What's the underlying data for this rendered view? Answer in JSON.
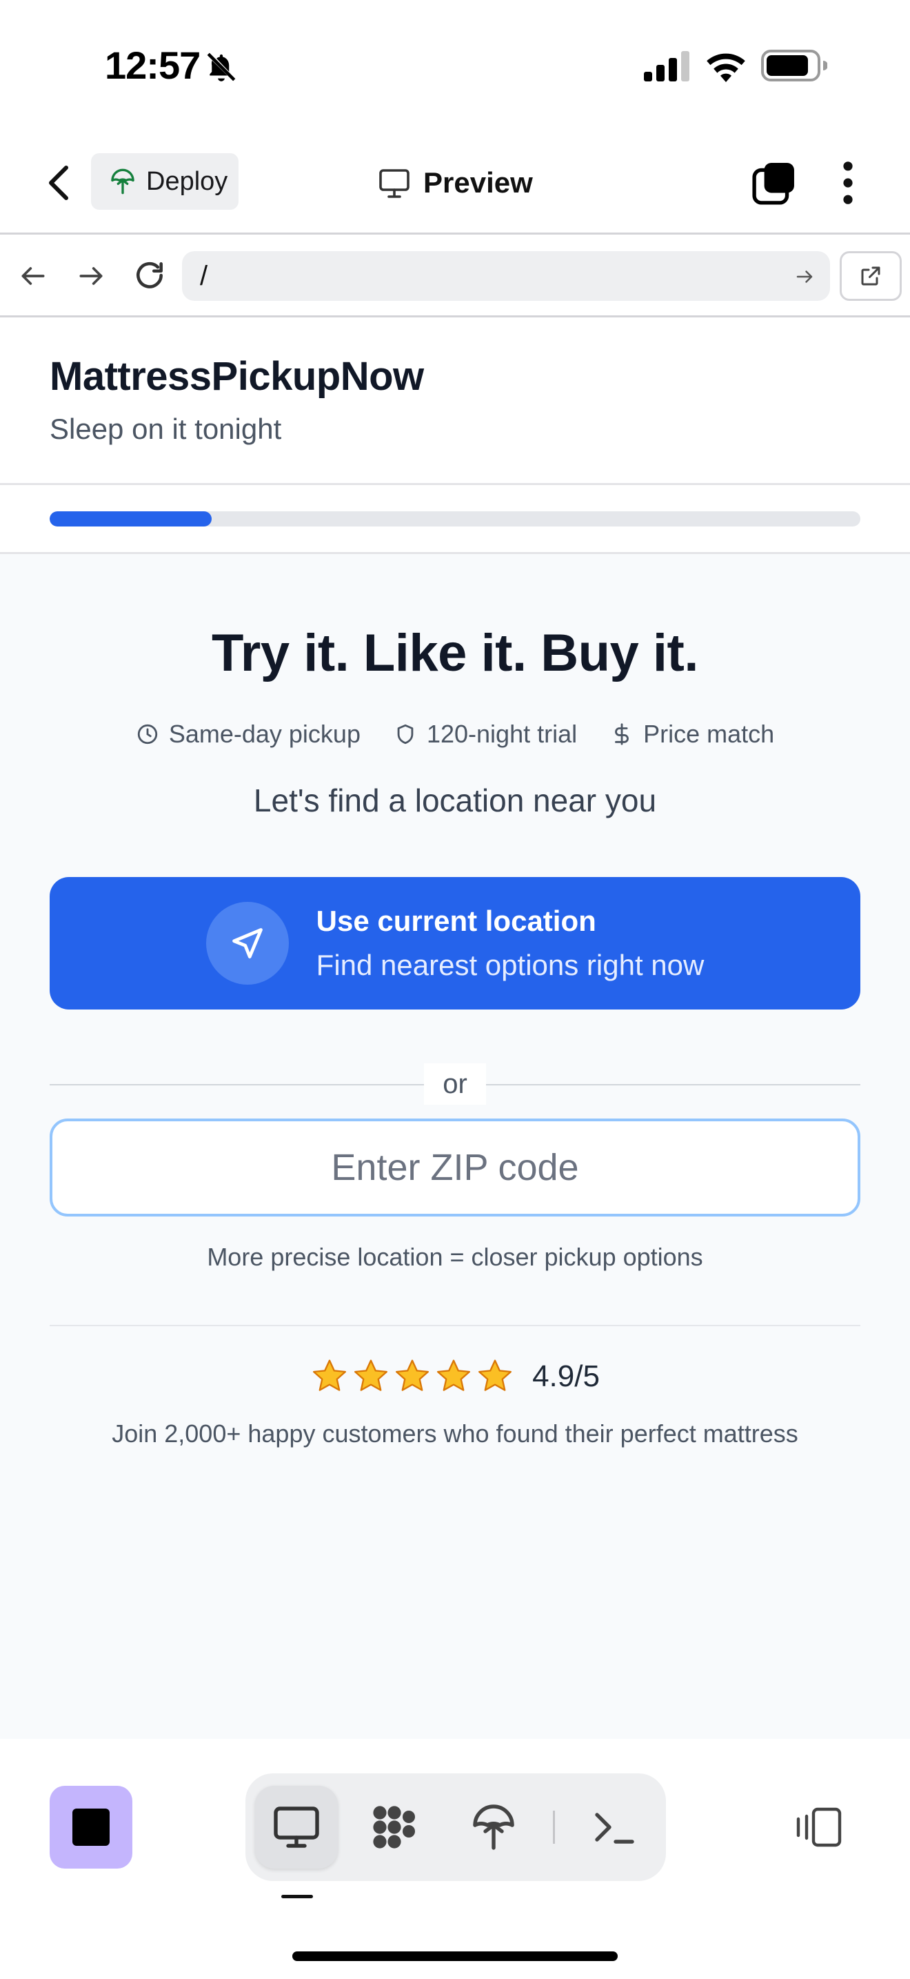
{
  "status_bar": {
    "time": "12:57",
    "icons": [
      "bell-slash-icon",
      "signal-icon",
      "wifi-icon",
      "battery-icon"
    ]
  },
  "app_header": {
    "deploy_label": "Deploy",
    "title": "Preview",
    "icons": [
      "chevron-left-icon",
      "deploy-icon",
      "monitor-icon",
      "tabs-icon",
      "more-vertical-icon"
    ]
  },
  "browser": {
    "url": "/",
    "icons": [
      "arrow-left-icon",
      "arrow-right-icon",
      "reload-icon",
      "arrow-go-icon",
      "external-link-icon"
    ]
  },
  "site": {
    "brand": "MattressPickupNow",
    "tagline": "Sleep on it tonight",
    "progress": 0.2
  },
  "hero": {
    "title": "Try it. Like it. Buy it.",
    "features": [
      {
        "icon": "clock-icon",
        "label": "Same-day pickup"
      },
      {
        "icon": "shield-icon",
        "label": "120-night trial"
      },
      {
        "icon": "dollar-icon",
        "label": "Price match"
      }
    ],
    "find_text": "Let's find a location near you"
  },
  "location_button": {
    "title": "Use current location",
    "subtitle": "Find nearest options right now",
    "icon": "navigation-arrow-icon"
  },
  "divider": {
    "label": "or"
  },
  "zip": {
    "placeholder": "Enter ZIP code",
    "value": "",
    "hint": "More precise location = closer pickup options"
  },
  "rating": {
    "stars": 5,
    "value": "4.9/5",
    "social_proof": "Join 2,000+ happy customers who found their perfect mattress"
  },
  "bottom_toolbar": {
    "items": [
      "monitor-icon",
      "apps-grid-icon",
      "deploy-icon",
      "terminal-icon"
    ],
    "active_index": 0,
    "icons": [
      "app-square-icon",
      "panel-toggle-icon"
    ]
  },
  "colors": {
    "accent": "#2563eb",
    "app_icon_bg": "#c4b5fd",
    "page_bg": "#f8fafc"
  }
}
